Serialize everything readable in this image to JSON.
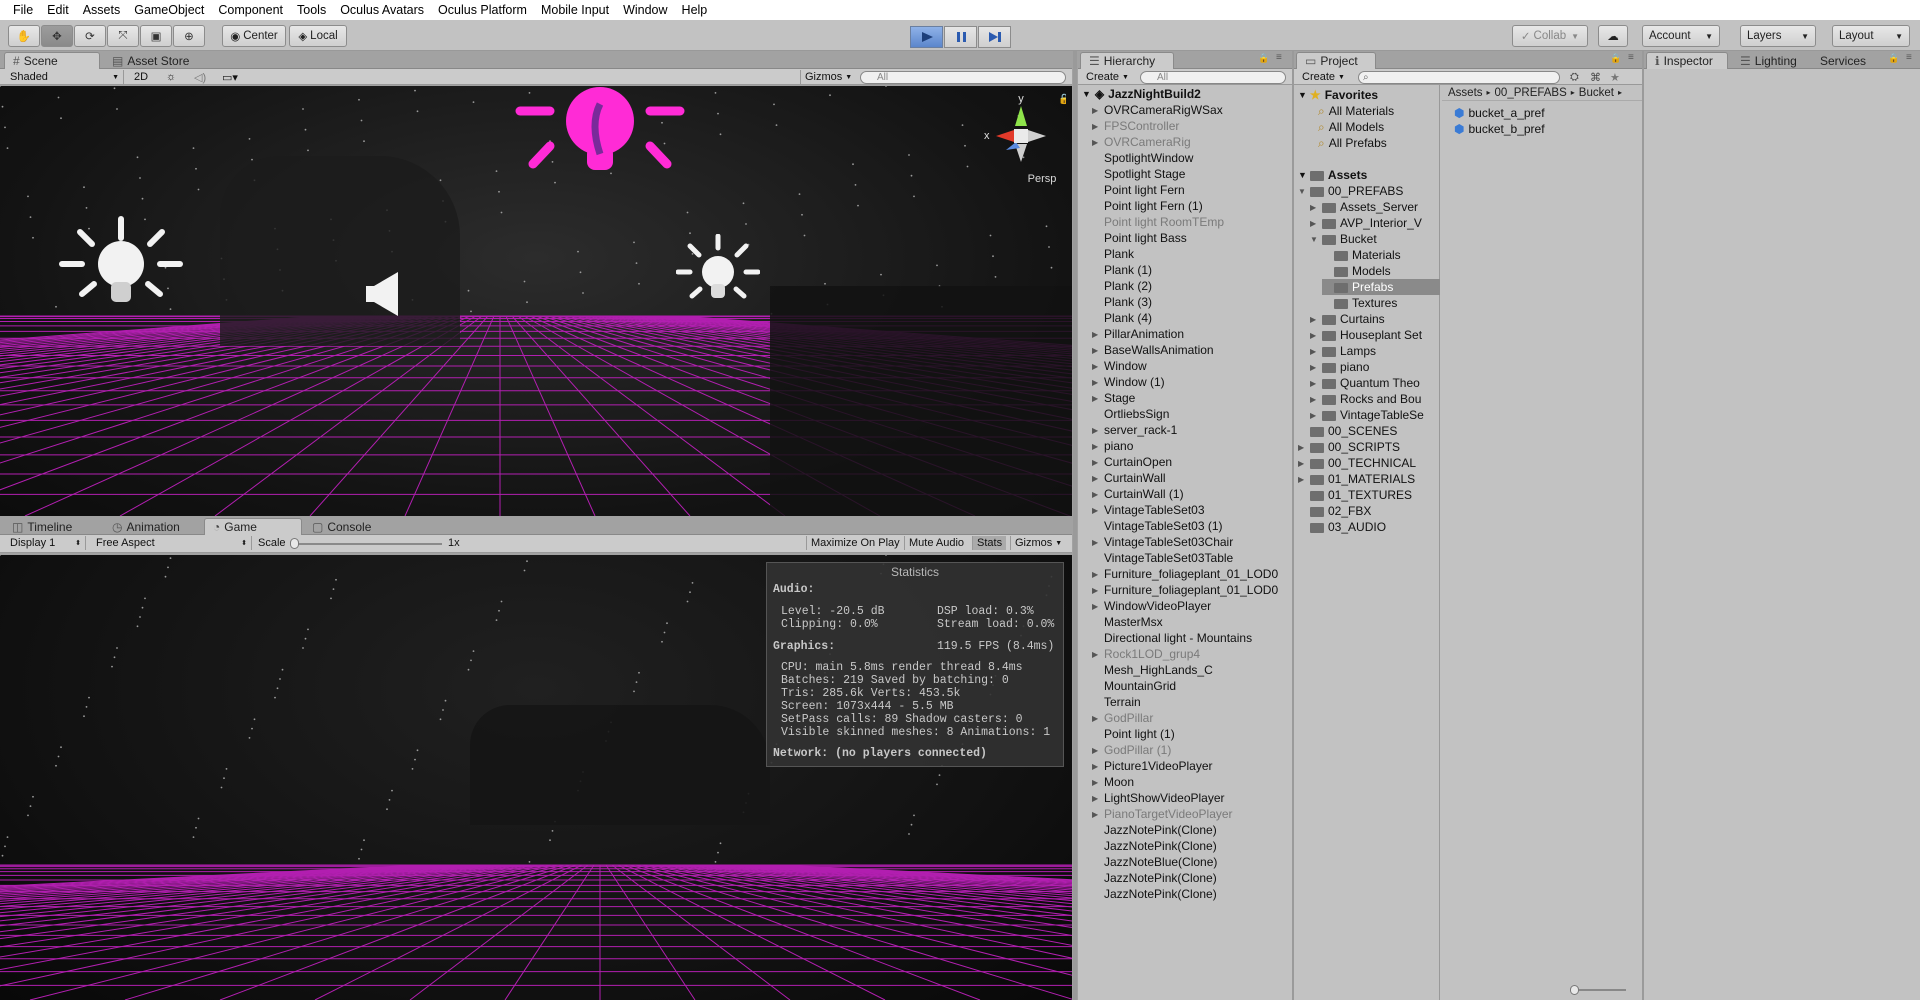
{
  "menubar": {
    "items": [
      "File",
      "Edit",
      "Assets",
      "GameObject",
      "Component",
      "Tools",
      "Oculus Avatars",
      "Oculus Platform",
      "Mobile Input",
      "Window",
      "Help"
    ]
  },
  "toolbar": {
    "pivot_label": "Center",
    "space_label": "Local",
    "collab_label": "Collab",
    "account_label": "Account",
    "layers_label": "Layers",
    "layout_label": "Layout"
  },
  "scene": {
    "tabs": [
      "Scene",
      "Asset Store"
    ],
    "shading": "Shaded",
    "mode_2d": "2D",
    "gizmos": "Gizmos",
    "search_placeholder": "All",
    "persp": "Persp",
    "axis_y": "y",
    "axis_x": "x"
  },
  "game": {
    "tabs": [
      "Timeline",
      "Animation",
      "Game",
      "Console"
    ],
    "display": "Display 1",
    "aspect": "Free Aspect",
    "scale_label": "Scale",
    "scale_value": "1x",
    "maximize": "Maximize On Play",
    "mute": "Mute Audio",
    "stats": "Stats",
    "gizmos": "Gizmos"
  },
  "stats_panel": {
    "title": "Statistics",
    "audio": "Audio:",
    "level": "Level: -20.5 dB",
    "dsp": "DSP load: 0.3%",
    "clipping": "Clipping: 0.0%",
    "stream": "Stream load: 0.0%",
    "graphics": "Graphics:",
    "fps": "119.5 FPS (8.4ms)",
    "cpu": "CPU: main 5.8ms  render thread 8.4ms",
    "batches": "Batches: 219     Saved by batching: 0",
    "tris": "Tris: 285.6k      Verts: 453.5k",
    "screen": "Screen: 1073x444 - 5.5 MB",
    "setpass": "SetPass calls: 89    Shadow casters: 0",
    "skinned": "Visible skinned meshes: 8  Animations: 1",
    "network": "Network: (no players connected)"
  },
  "hierarchy": {
    "tab": "Hierarchy",
    "create": "Create",
    "search_placeholder": "All",
    "scene_name": "JazzNightBuild2",
    "items": [
      {
        "label": "OVRCameraRigWSax",
        "arrow": true,
        "dim": false
      },
      {
        "label": "FPSController",
        "arrow": true,
        "dim": true
      },
      {
        "label": "OVRCameraRig",
        "arrow": true,
        "dim": true
      },
      {
        "label": "SpotlightWindow",
        "arrow": false,
        "dim": false
      },
      {
        "label": "Spotlight Stage",
        "arrow": false,
        "dim": false
      },
      {
        "label": "Point light Fern",
        "arrow": false,
        "dim": false
      },
      {
        "label": "Point light Fern (1)",
        "arrow": false,
        "dim": false
      },
      {
        "label": "Point light RoomTEmp",
        "arrow": false,
        "dim": true
      },
      {
        "label": "Point light Bass",
        "arrow": false,
        "dim": false
      },
      {
        "label": "Plank",
        "arrow": false,
        "dim": false
      },
      {
        "label": "Plank (1)",
        "arrow": false,
        "dim": false
      },
      {
        "label": "Plank (2)",
        "arrow": false,
        "dim": false
      },
      {
        "label": "Plank (3)",
        "arrow": false,
        "dim": false
      },
      {
        "label": "Plank (4)",
        "arrow": false,
        "dim": false
      },
      {
        "label": "PillarAnimation",
        "arrow": true,
        "dim": false
      },
      {
        "label": "BaseWallsAnimation",
        "arrow": true,
        "dim": false
      },
      {
        "label": "Window",
        "arrow": true,
        "dim": false
      },
      {
        "label": "Window (1)",
        "arrow": true,
        "dim": false
      },
      {
        "label": "Stage",
        "arrow": true,
        "dim": false
      },
      {
        "label": "OrtliebsSign",
        "arrow": false,
        "dim": false
      },
      {
        "label": "server_rack-1",
        "arrow": true,
        "dim": false
      },
      {
        "label": "piano",
        "arrow": true,
        "dim": false
      },
      {
        "label": "CurtainOpen",
        "arrow": true,
        "dim": false
      },
      {
        "label": "CurtainWall",
        "arrow": true,
        "dim": false
      },
      {
        "label": "CurtainWall (1)",
        "arrow": true,
        "dim": false
      },
      {
        "label": "VintageTableSet03",
        "arrow": true,
        "dim": false
      },
      {
        "label": "VintageTableSet03 (1)",
        "arrow": false,
        "dim": false
      },
      {
        "label": "VintageTableSet03Chair",
        "arrow": true,
        "dim": false
      },
      {
        "label": "VintageTableSet03Table",
        "arrow": false,
        "dim": false
      },
      {
        "label": "Furniture_foliageplant_01_LOD0",
        "arrow": true,
        "dim": false
      },
      {
        "label": "Furniture_foliageplant_01_LOD0",
        "arrow": true,
        "dim": false
      },
      {
        "label": "WindowVideoPlayer",
        "arrow": true,
        "dim": false
      },
      {
        "label": "MasterMsx",
        "arrow": false,
        "dim": false
      },
      {
        "label": "Directional light - Mountains",
        "arrow": false,
        "dim": false
      },
      {
        "label": "Rock1LOD_grup4",
        "arrow": true,
        "dim": true
      },
      {
        "label": "Mesh_HighLands_C",
        "arrow": false,
        "dim": false
      },
      {
        "label": "MountainGrid",
        "arrow": false,
        "dim": false
      },
      {
        "label": "Terrain",
        "arrow": false,
        "dim": false
      },
      {
        "label": "GodPillar",
        "arrow": true,
        "dim": true
      },
      {
        "label": "Point light (1)",
        "arrow": false,
        "dim": false
      },
      {
        "label": "GodPillar (1)",
        "arrow": true,
        "dim": true
      },
      {
        "label": "Picture1VideoPlayer",
        "arrow": true,
        "dim": false
      },
      {
        "label": "Moon",
        "arrow": true,
        "dim": false
      },
      {
        "label": "LightShowVideoPlayer",
        "arrow": true,
        "dim": false
      },
      {
        "label": "PianoTargetVideoPlayer",
        "arrow": true,
        "dim": true
      },
      {
        "label": "JazzNotePink(Clone)",
        "arrow": false,
        "dim": false
      },
      {
        "label": "JazzNotePink(Clone)",
        "arrow": false,
        "dim": false
      },
      {
        "label": "JazzNoteBlue(Clone)",
        "arrow": false,
        "dim": false
      },
      {
        "label": "JazzNotePink(Clone)",
        "arrow": false,
        "dim": false
      },
      {
        "label": "JazzNotePink(Clone)",
        "arrow": false,
        "dim": false
      }
    ]
  },
  "project": {
    "tab": "Project",
    "create": "Create",
    "favorites": "Favorites",
    "fav_items": [
      "All Materials",
      "All Models",
      "All Prefabs"
    ],
    "assets_root": "Assets",
    "tree": [
      {
        "label": "00_PREFABS",
        "depth": 0,
        "arrow": "open"
      },
      {
        "label": "Assets_Server",
        "depth": 1,
        "arrow": "closed"
      },
      {
        "label": "AVP_Interior_V",
        "depth": 1,
        "arrow": "closed"
      },
      {
        "label": "Bucket",
        "depth": 1,
        "arrow": "open"
      },
      {
        "label": "Materials",
        "depth": 2,
        "arrow": "none"
      },
      {
        "label": "Models",
        "depth": 2,
        "arrow": "none"
      },
      {
        "label": "Prefabs",
        "depth": 2,
        "arrow": "none",
        "selected": true
      },
      {
        "label": "Textures",
        "depth": 2,
        "arrow": "none"
      },
      {
        "label": "Curtains",
        "depth": 1,
        "arrow": "closed"
      },
      {
        "label": "Houseplant Set",
        "depth": 1,
        "arrow": "closed"
      },
      {
        "label": "Lamps",
        "depth": 1,
        "arrow": "closed"
      },
      {
        "label": "piano",
        "depth": 1,
        "arrow": "closed"
      },
      {
        "label": "Quantum Theo",
        "depth": 1,
        "arrow": "closed"
      },
      {
        "label": "Rocks and Bou",
        "depth": 1,
        "arrow": "closed"
      },
      {
        "label": "VintageTableSe",
        "depth": 1,
        "arrow": "closed"
      },
      {
        "label": "00_SCENES",
        "depth": 0,
        "arrow": "none"
      },
      {
        "label": "00_SCRIPTS",
        "depth": 0,
        "arrow": "closed"
      },
      {
        "label": "00_TECHNICAL",
        "depth": 0,
        "arrow": "closed"
      },
      {
        "label": "01_MATERIALS",
        "depth": 0,
        "arrow": "closed"
      },
      {
        "label": "01_TEXTURES",
        "depth": 0,
        "arrow": "none"
      },
      {
        "label": "02_FBX",
        "depth": 0,
        "arrow": "none"
      },
      {
        "label": "03_AUDIO",
        "depth": 0,
        "arrow": "none"
      }
    ],
    "breadcrumb": [
      "Assets",
      "00_PREFABS",
      "Bucket"
    ],
    "files": [
      "bucket_a_pref",
      "bucket_b_pref"
    ]
  },
  "inspector": {
    "tabs": [
      "Inspector",
      "Lighting",
      "Services"
    ]
  },
  "colors": {
    "accent": "#ff2bd6",
    "grid": "#b21fb0",
    "play_blue": "#5b86cc"
  }
}
